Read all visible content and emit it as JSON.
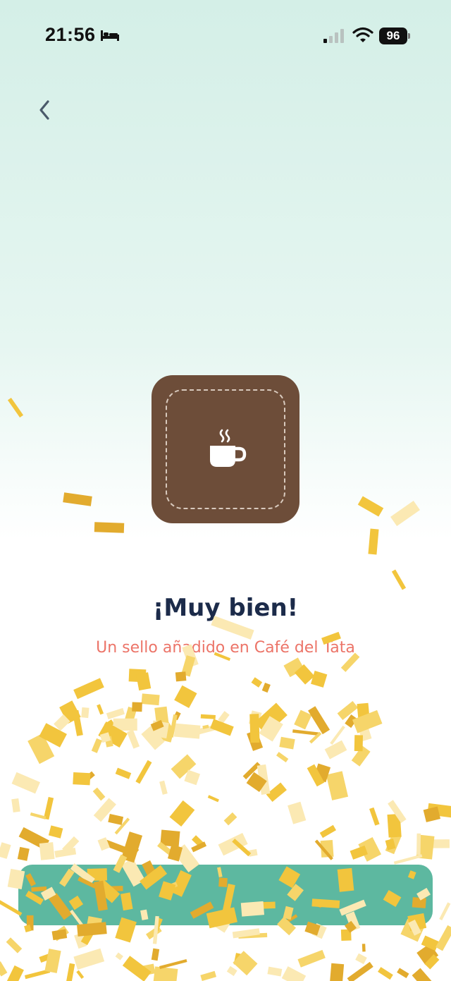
{
  "status_bar": {
    "time": "21:56",
    "battery": "96",
    "icons": [
      "bed-icon",
      "signal-icon",
      "wifi-icon",
      "battery-icon"
    ]
  },
  "nav": {
    "back_icon": "chevron-left-icon"
  },
  "stamp": {
    "icon": "coffee-cup-icon",
    "colors": {
      "background": "#6d4d39",
      "dashed_border": "#d8c9bd"
    }
  },
  "message": {
    "title": "¡Muy bien!",
    "subtitle": "Un sello añadido en Café del Tata"
  },
  "cta": {
    "label": "",
    "color": "#5db8a0"
  },
  "colors": {
    "title": "#1c2b4a",
    "subtitle": "#ec7468",
    "confetti": [
      "#f2c53d",
      "#e2ab2e",
      "#fbe9b3",
      "#f6d56a"
    ]
  }
}
